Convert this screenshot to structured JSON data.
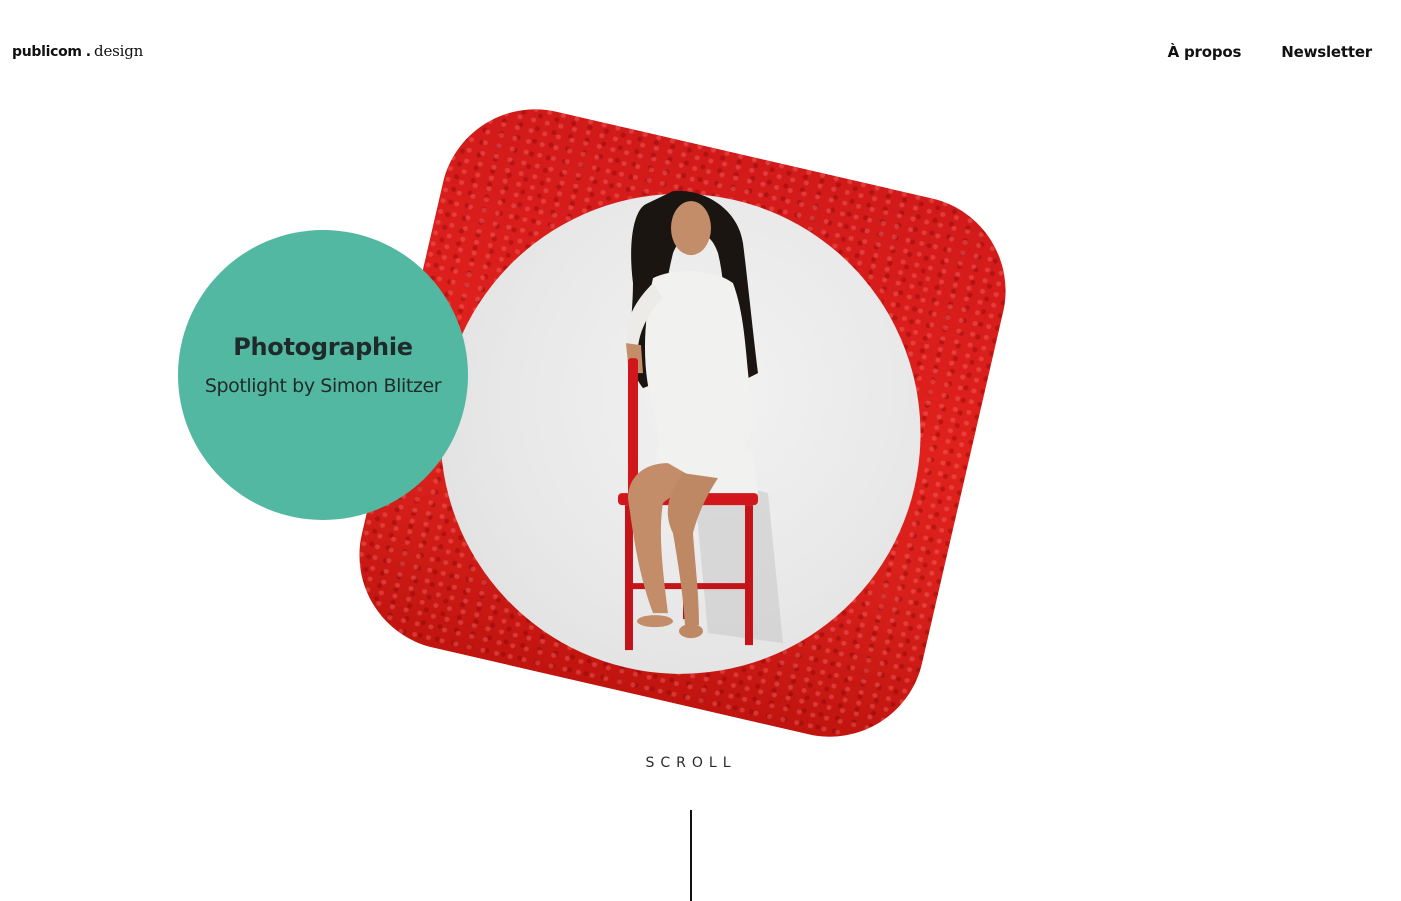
{
  "header": {
    "logo": {
      "word": "publicom",
      "dot": ".",
      "suffix": "design"
    },
    "nav": [
      {
        "label": "À propos"
      },
      {
        "label": "Newsletter"
      }
    ]
  },
  "hero": {
    "category": {
      "title": "Photographie",
      "subtitle": "Spotlight by Simon Blitzer"
    },
    "colors": {
      "circle": "#52b8a1",
      "backdrop": "#d8201b",
      "spotlight": "#e8e8e8"
    }
  },
  "scroll": {
    "label": "SCROLL"
  }
}
